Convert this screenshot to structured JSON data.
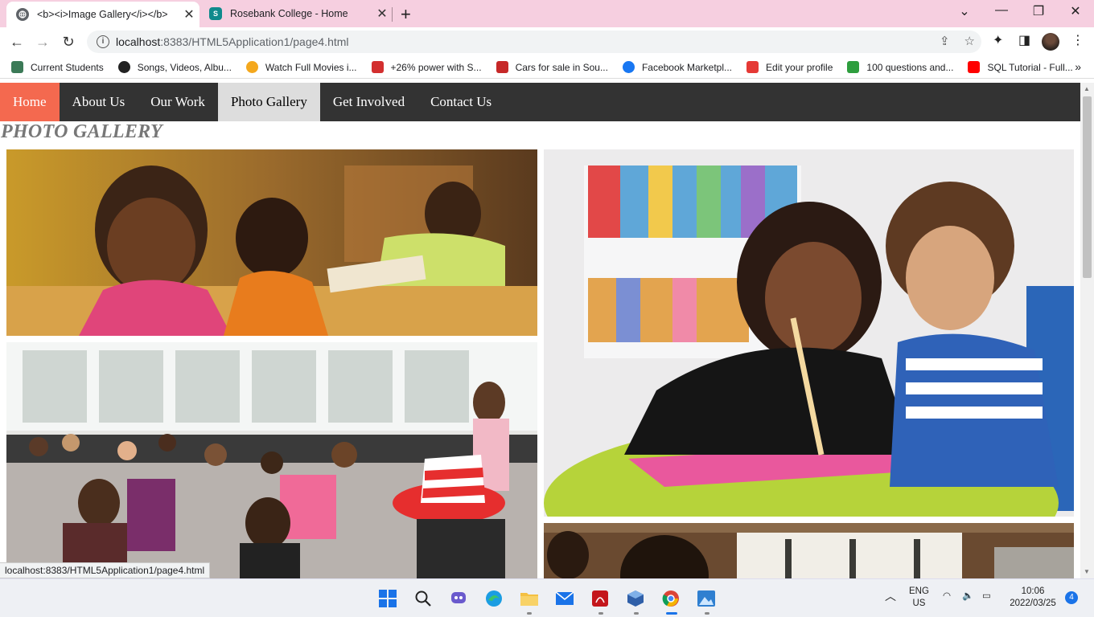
{
  "browser": {
    "tabs": [
      {
        "title": "<b><i>Image Gallery</i></b>",
        "active": true
      },
      {
        "title": "Rosebank College - Home",
        "active": false
      }
    ],
    "url_host": "localhost",
    "url_rest": ":8383/HTML5Application1/page4.html",
    "bookmarks": [
      {
        "label": "Current Students",
        "color": "#3b7a57"
      },
      {
        "label": "Songs, Videos, Albu...",
        "color": "#222222"
      },
      {
        "label": "Watch Full Movies i...",
        "color": "#f4a81d"
      },
      {
        "label": "+26% power with S...",
        "color": "#d32f2f"
      },
      {
        "label": "Cars for sale in Sou...",
        "color": "#c62828"
      },
      {
        "label": "Facebook Marketpl...",
        "color": "#1877f2"
      },
      {
        "label": "Edit your profile",
        "color": "#e53935"
      },
      {
        "label": "100 questions and...",
        "color": "#2e9e3e"
      },
      {
        "label": "SQL Tutorial - Full...",
        "color": "#ff0000"
      }
    ],
    "status_text": "localhost:8383/HTML5Application1/page4.html"
  },
  "page": {
    "nav": [
      "Home",
      "About Us",
      "Our Work",
      "Photo Gallery",
      "Get Involved",
      "Contact Us"
    ],
    "active_nav": "Photo Gallery",
    "heading": "PHOTO GALLERY",
    "accent_color": "#f4694f",
    "navbar_color": "#333333"
  },
  "taskbar": {
    "lang_top": "ENG",
    "lang_bottom": "US",
    "time": "10:06",
    "date": "2022/03/25",
    "notifications": "4"
  }
}
